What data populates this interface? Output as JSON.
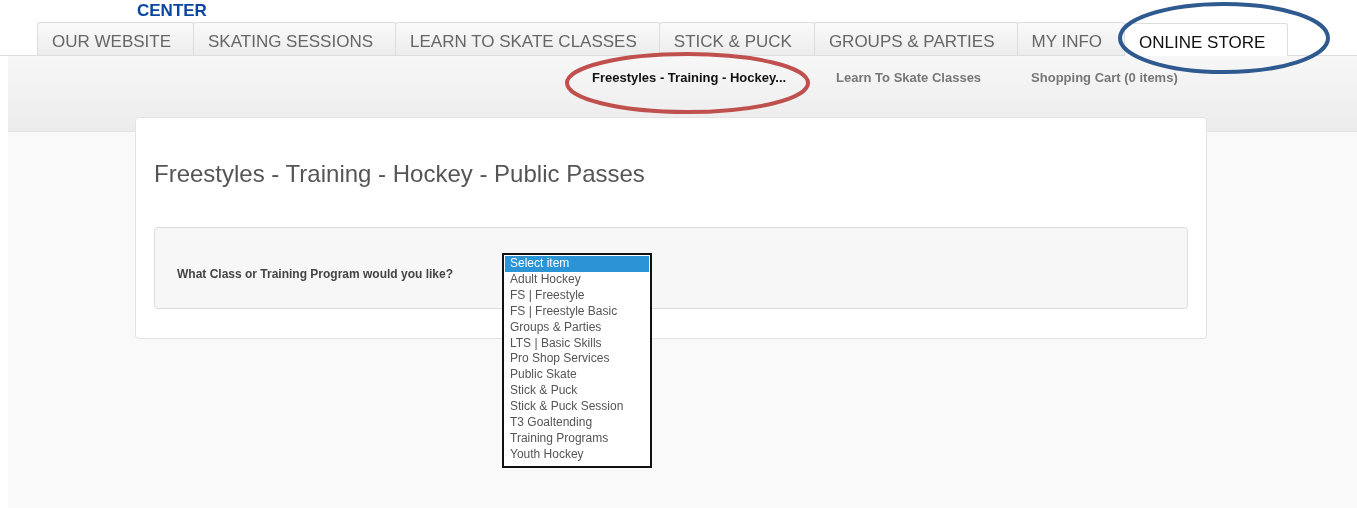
{
  "logo": {
    "text": "CENTER"
  },
  "tabs": [
    {
      "label": "OUR WEBSITE",
      "selected": false
    },
    {
      "label": "SKATING SESSIONS",
      "selected": false
    },
    {
      "label": "LEARN TO SKATE CLASSES",
      "selected": false
    },
    {
      "label": "STICK & PUCK",
      "selected": false
    },
    {
      "label": "GROUPS & PARTIES",
      "selected": false
    },
    {
      "label": "MY INFO",
      "selected": false
    },
    {
      "label": "ONLINE STORE",
      "selected": true
    }
  ],
  "subnav": [
    {
      "label": "Freestyles - Training - Hockey...",
      "selected": true
    },
    {
      "label": "Learn To Skate Classes",
      "selected": false
    },
    {
      "label": "Shopping Cart (0 items)",
      "selected": false
    }
  ],
  "page": {
    "title": "Freestyles - Training - Hockey - Public Passes",
    "question": "What Class or Training Program would you like?"
  },
  "listbox": [
    {
      "label": "Select item",
      "selected": true
    },
    {
      "label": "Adult Hockey",
      "selected": false
    },
    {
      "label": "FS | Freestyle",
      "selected": false
    },
    {
      "label": "FS | Freestyle Basic",
      "selected": false
    },
    {
      "label": "Groups & Parties",
      "selected": false
    },
    {
      "label": "LTS | Basic Skills",
      "selected": false
    },
    {
      "label": "Pro Shop Services",
      "selected": false
    },
    {
      "label": "Public Skate",
      "selected": false
    },
    {
      "label": "Stick & Puck",
      "selected": false
    },
    {
      "label": "Stick & Puck Session",
      "selected": false
    },
    {
      "label": "T3 Goaltending",
      "selected": false
    },
    {
      "label": "Training Programs",
      "selected": false
    },
    {
      "label": "Youth Hockey",
      "selected": false
    }
  ],
  "annotations": [
    {
      "kind": "ellipse",
      "color": "#c0504d"
    },
    {
      "kind": "ellipse",
      "color": "#2f5a8f"
    }
  ]
}
